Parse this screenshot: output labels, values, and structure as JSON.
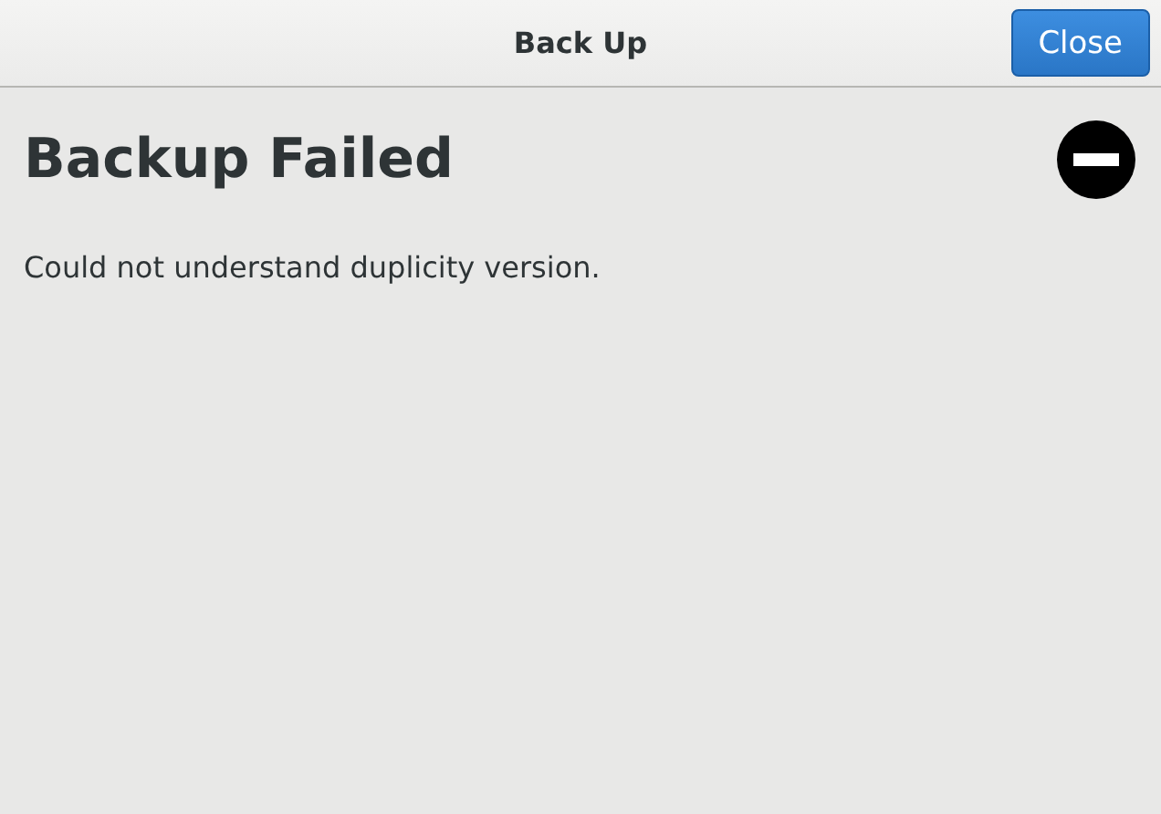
{
  "window": {
    "title": "Back Up"
  },
  "buttons": [
    {
      "label": "Close",
      "kind": "suggested"
    }
  ],
  "heading": "Backup Failed",
  "message": "Could not understand duplicity version."
}
